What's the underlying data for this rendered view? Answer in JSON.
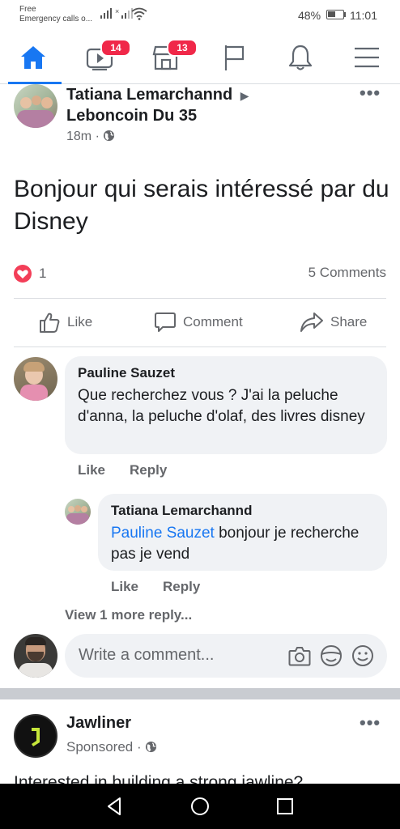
{
  "status_bar": {
    "carrier_line1": "Free",
    "carrier_line2": "Emergency calls o...",
    "battery": "48%",
    "time": "11:01"
  },
  "nav": {
    "items": [
      {
        "icon": "home-icon",
        "active": true
      },
      {
        "icon": "video-icon",
        "badge": "14"
      },
      {
        "icon": "marketplace-icon",
        "badge": "13"
      },
      {
        "icon": "flag-icon"
      },
      {
        "icon": "bell-icon"
      },
      {
        "icon": "menu-icon"
      }
    ]
  },
  "post": {
    "author": "Tatiana Lemarchannd",
    "group": "Leboncoin Du 35",
    "time": "18m",
    "text": "Bonjour qui serais intéressé par du Disney",
    "reaction_count": "1",
    "comments_count": "5 Comments",
    "actions": {
      "like": "Like",
      "comment": "Comment",
      "share": "Share"
    }
  },
  "comments": [
    {
      "author": "Pauline Sauzet",
      "text": "Que recherchez vous ? J'ai la peluche d'anna, la peluche d'olaf, des livres disney",
      "like": "Like",
      "reply": "Reply"
    },
    {
      "author": "Tatiana Lemarchannd",
      "mention": "Pauline Sauzet",
      "text": " bonjour je recherche pas je vend",
      "like": "Like",
      "reply": "Reply"
    }
  ],
  "view_more": "View 1 more reply...",
  "write_comment": {
    "placeholder": "Write a comment..."
  },
  "ad": {
    "name": "Jawliner",
    "sponsored": "Sponsored",
    "text": "Interested in building a strong jawline?"
  },
  "colors": {
    "accent": "#1877f2",
    "badge": "#f02849",
    "bubble": "#f0f2f5",
    "love": "#f33e58"
  }
}
